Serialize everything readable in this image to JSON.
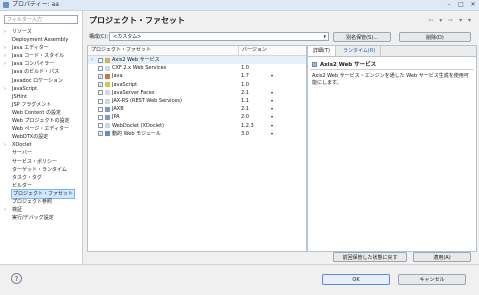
{
  "window": {
    "title": "プロパティー: aa"
  },
  "sidebar": {
    "filter_placeholder": "フィルター入力",
    "items": [
      {
        "label": "リソース",
        "expand": "›"
      },
      {
        "label": "Deployment Assembly",
        "expand": ""
      },
      {
        "label": "Java エディター",
        "expand": "›"
      },
      {
        "label": "Java コード・スタイル",
        "expand": "›"
      },
      {
        "label": "Java コンパイラー",
        "expand": "›"
      },
      {
        "label": "Java のビルド・パス",
        "expand": ""
      },
      {
        "label": "Javadoc ロケーション",
        "expand": ""
      },
      {
        "label": "JavaScript",
        "expand": "›"
      },
      {
        "label": "JSHint",
        "expand": ""
      },
      {
        "label": "JSP フラグメント",
        "expand": ""
      },
      {
        "label": "Web Content の設定",
        "expand": ""
      },
      {
        "label": "Web プロジェクトの設定",
        "expand": ""
      },
      {
        "label": "Web ページ・エディター",
        "expand": ""
      },
      {
        "label": "WebDTXの設定",
        "expand": ""
      },
      {
        "label": "XDoclet",
        "expand": "›"
      },
      {
        "label": "サーバー",
        "expand": ""
      },
      {
        "label": "サービス・ポリシー",
        "expand": ""
      },
      {
        "label": "ターゲット・ランタイム",
        "expand": ""
      },
      {
        "label": "タスク・タグ",
        "expand": ""
      },
      {
        "label": "ビルダー",
        "expand": ""
      },
      {
        "label": "プロジェクト・ファセット",
        "expand": ""
      },
      {
        "label": "プロジェクト参照",
        "expand": ""
      },
      {
        "label": "検証",
        "expand": "›"
      },
      {
        "label": "実行/デバッグ設定",
        "expand": ""
      }
    ],
    "selected_index": 20
  },
  "main": {
    "title": "プロジェクト・ファセット",
    "nav_icons": "⇦ ▾ ⇨ ▾ ▾",
    "config_label": "構成(C):",
    "config_value": "<カスタム>",
    "save_as_label": "別名保管(S)...",
    "delete_label": "削除(D)",
    "facets_header": {
      "name": "プロジェクト・ファセット",
      "version": "バージョン"
    },
    "facets": [
      {
        "name": "Axis2 Web サービス",
        "version": "",
        "checked": false,
        "expandable": true,
        "icon": "folder-icon",
        "dropdown": false,
        "highlighted": true
      },
      {
        "name": "CXF 2.x Web Services",
        "version": "1.0",
        "checked": false,
        "expandable": false,
        "icon": "document-icon",
        "dropdown": false,
        "highlighted": false
      },
      {
        "name": "Java",
        "version": "1.7",
        "checked": true,
        "expandable": false,
        "icon": "java-icon",
        "dropdown": true,
        "highlighted": false
      },
      {
        "name": "JavaScript",
        "version": "1.0",
        "checked": true,
        "expandable": false,
        "icon": "javascript-icon",
        "dropdown": false,
        "highlighted": false
      },
      {
        "name": "JavaServer Faces",
        "version": "2.1",
        "checked": false,
        "expandable": false,
        "icon": "document-icon",
        "dropdown": true,
        "highlighted": false
      },
      {
        "name": "JAX-RS (REST Web Services)",
        "version": "1.1",
        "checked": false,
        "expandable": false,
        "icon": "document-icon",
        "dropdown": true,
        "highlighted": false
      },
      {
        "name": "JAXB",
        "version": "2.1",
        "checked": false,
        "expandable": false,
        "icon": "jaxb-icon",
        "dropdown": true,
        "highlighted": false
      },
      {
        "name": "JPA",
        "version": "2.0",
        "checked": false,
        "expandable": false,
        "icon": "jpa-icon",
        "dropdown": true,
        "highlighted": false
      },
      {
        "name": "WebDoclet (XDoclet)",
        "version": "1.2.3",
        "checked": false,
        "expandable": false,
        "icon": "document-icon",
        "dropdown": true,
        "highlighted": false
      },
      {
        "name": "動的 Web モジュール",
        "version": "3.0",
        "checked": true,
        "expandable": false,
        "icon": "web-module-icon",
        "dropdown": true,
        "highlighted": false
      }
    ],
    "detail_tabs": [
      "詳細(T)",
      "ランタイム(R)"
    ],
    "detail_title": "Axis2 Web サービス",
    "detail_desc": "Axis2 Web サービス・エンジンを通した Web サービス生成を使用可能にします。",
    "restore_label": "前回保管した状態に戻す",
    "apply_label": "適用(A)"
  },
  "footer": {
    "help": "?",
    "ok_label": "OK",
    "cancel_label": "キャンセル"
  },
  "colors": {
    "selection": "#cde8ff",
    "accent": "#2d5fa8",
    "check": "#2d5fa8"
  }
}
